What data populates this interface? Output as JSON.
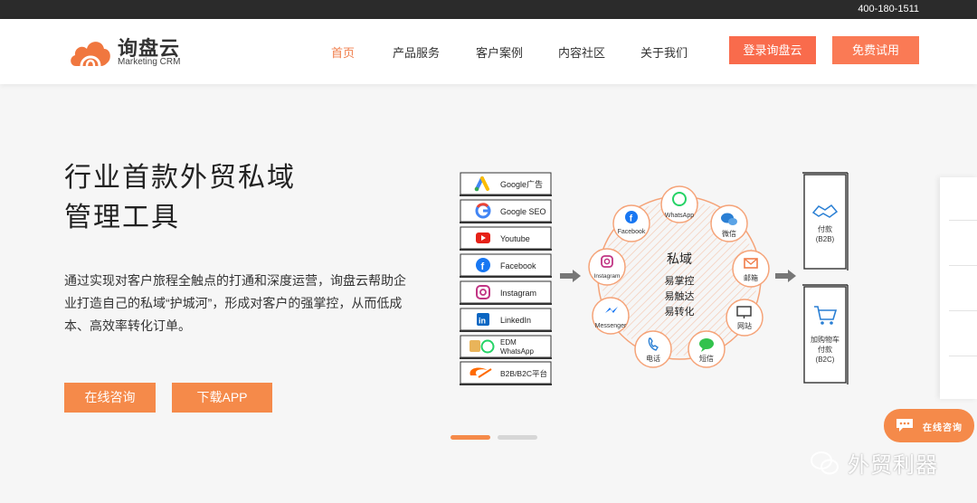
{
  "topbar": {
    "phone": "400-180-1511"
  },
  "brand": {
    "name": "询盘云",
    "sub": "Marketing CRM"
  },
  "nav": [
    {
      "label": "首页"
    },
    {
      "label": "产品服务"
    },
    {
      "label": "客户案例"
    },
    {
      "label": "内容社区"
    },
    {
      "label": "关于我们"
    }
  ],
  "buttons": {
    "login": "登录询盘云",
    "trial": "免费试用"
  },
  "hero": {
    "title_line1": "行业首款外贸私域",
    "title_line2": "管理工具",
    "desc": "通过实现对客户旅程全触点的打通和深度运营，询盘云帮助企业打造自己的私域“护城河”，形成对客户的强掌控，从而低成本、高效率转化订单。",
    "cta_consult": "在线咨询",
    "cta_download": "下载APP"
  },
  "diagram": {
    "channels": [
      {
        "label": "Google广告",
        "icon": "google-ads-icon"
      },
      {
        "label": "Google SEO",
        "icon": "google-icon"
      },
      {
        "label": "Youtube",
        "icon": "youtube-icon"
      },
      {
        "label": "Facebook",
        "icon": "facebook-icon"
      },
      {
        "label": "Instagram",
        "icon": "instagram-icon"
      },
      {
        "label": "LinkedIn",
        "icon": "linkedin-icon"
      },
      {
        "label": "EDM",
        "label2": "WhatsApp",
        "icon": "edm-whatsapp-icon"
      },
      {
        "label": "B2B/B2C平台",
        "icon": "alibaba-icon"
      }
    ],
    "center": {
      "title": "私域",
      "line1": "易掌控",
      "line2": "易触达",
      "line3": "易转化"
    },
    "nodes": [
      {
        "label": "WhatsApp"
      },
      {
        "label": "微信"
      },
      {
        "label": "邮箱"
      },
      {
        "label": "网站"
      },
      {
        "label": "短信"
      },
      {
        "label": "电话"
      },
      {
        "label": "Messenger"
      },
      {
        "label": "Instagram"
      },
      {
        "label": "Facebook"
      }
    ],
    "results": [
      {
        "line1": "付款",
        "line2": "(B2B)"
      },
      {
        "line1": "加购物车",
        "line2": "付款",
        "line3": "(B2C)"
      }
    ]
  },
  "chat": {
    "label": "在线咨询"
  },
  "watermark": {
    "text": "外贸利器"
  },
  "colors": {
    "accent": "#f58a4a",
    "login": "#f96b4c",
    "topbar": "#2b2b2b"
  }
}
